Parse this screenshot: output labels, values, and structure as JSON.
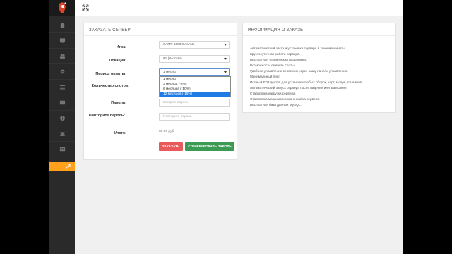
{
  "colors": {
    "accent": "#ffa11a",
    "order_button": "#e95a5a",
    "generate_button": "#3c9a52",
    "selected_option": "#1e7be6"
  },
  "order_form": {
    "title": "ЗАКАЗАТЬ СЕРВЕР",
    "game_label": "Игра:",
    "game_value": "SAMP 1000 Слотов",
    "location_label": "Локация:",
    "location_value": "#1 | Москва",
    "period_label": "Период оплаты:",
    "period_value": "1 месяц",
    "period_options": [
      "1 месяц",
      "3 месяца (-5%)",
      "6 месяцев (-10%)",
      "12 месяцев (-15%)"
    ],
    "slots_label": "Количество слотов:",
    "password_label": "Пароль:",
    "password_placeholder": "Введите пароль",
    "repeat_label": "Повторите пароль:",
    "repeat_placeholder": "Повторите пароль",
    "total_label": "Итого:",
    "total_value": "80.00 руб.",
    "order_button": "ЗАКАЗАТЬ",
    "generate_button": "СГЕНЕРИРОВАТЬ ПАРОЛЬ"
  },
  "info_panel": {
    "title": "ИНФОРМАЦИЯ О ЗАКАЗЕ",
    "items": [
      "Автоматический заказ и установка сервера в течение минуты.",
      "Круглосуточная работа сервера.",
      "Бесплатная техническая поддержка.",
      "Возможность сменить слоты.",
      "Удобное управление сервером через нашу панель управления.",
      "Минимальный пинг.",
      "Полный FTP доступ для установки любых сборок, карт, модов, плагинов.",
      "Автоматический запуск сервера после падения или зависания.",
      "Статистика нагрузки сервера.",
      "Статистика максимального онлайна сервера.",
      "Бесплатная база данных MySQL."
    ]
  }
}
